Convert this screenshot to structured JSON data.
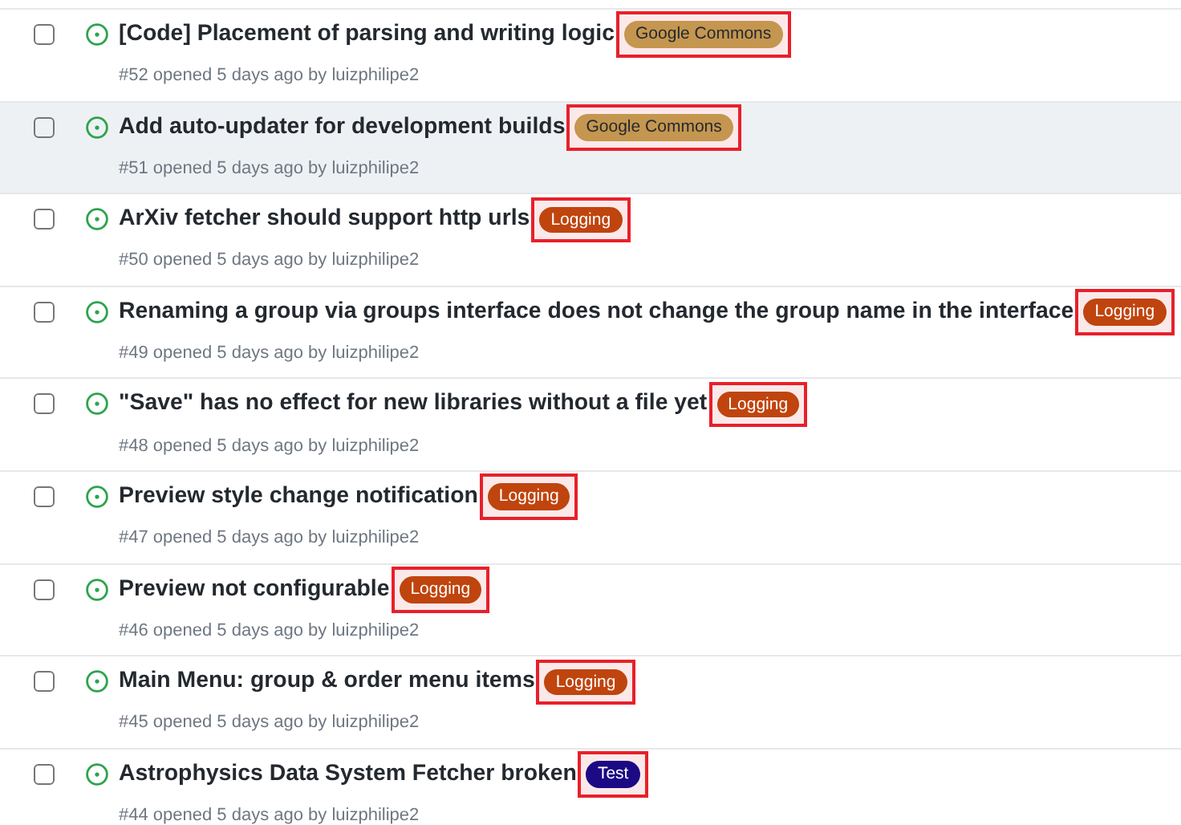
{
  "issues": [
    {
      "title": "[Code] Placement of parsing and writing logic",
      "meta": "#52 opened 5 days ago by luizphilipe2",
      "checked": false,
      "hovered": false,
      "label": {
        "text": "Google Commons",
        "color": "#c5964f",
        "highlighted": true
      }
    },
    {
      "title": "Add auto-updater for development builds",
      "meta": "#51 opened 5 days ago by luizphilipe2",
      "checked": false,
      "hovered": true,
      "label": {
        "text": "Google Commons",
        "color": "#c5964f",
        "highlighted": true
      }
    },
    {
      "title": "ArXiv fetcher should support http urls",
      "meta": "#50 opened 5 days ago by luizphilipe2",
      "checked": false,
      "hovered": false,
      "label": {
        "text": "Logging",
        "color": "#c0440d",
        "highlighted": true
      }
    },
    {
      "title": "Renaming a group via groups interface does not change the group name in the interface",
      "meta": "#49 opened 5 days ago by luizphilipe2",
      "checked": false,
      "hovered": false,
      "label": {
        "text": "Logging",
        "color": "#c0440d",
        "highlighted": true
      }
    },
    {
      "title": "\"Save\" has no effect for new libraries without a file yet",
      "meta": "#48 opened 5 days ago by luizphilipe2",
      "checked": false,
      "hovered": false,
      "label": {
        "text": "Logging",
        "color": "#c0440d",
        "highlighted": true
      }
    },
    {
      "title": "Preview style change notification",
      "meta": "#47 opened 5 days ago by luizphilipe2",
      "checked": false,
      "hovered": false,
      "label": {
        "text": "Logging",
        "color": "#c0440d",
        "highlighted": true
      }
    },
    {
      "title": "Preview not configurable",
      "meta": "#46 opened 5 days ago by luizphilipe2",
      "checked": false,
      "hovered": false,
      "label": {
        "text": "Logging",
        "color": "#c0440d",
        "highlighted": true
      }
    },
    {
      "title": "Main Menu: group & order menu items",
      "meta": "#45 opened 5 days ago by luizphilipe2",
      "checked": false,
      "hovered": false,
      "label": {
        "text": "Logging",
        "color": "#c0440d",
        "highlighted": true
      }
    },
    {
      "title": "Astrophysics Data System Fetcher broken",
      "meta": "#44 opened 5 days ago by luizphilipe2",
      "checked": false,
      "hovered": false,
      "label": {
        "text": "Test",
        "color": "#1b0a84",
        "highlighted": true
      }
    }
  ]
}
